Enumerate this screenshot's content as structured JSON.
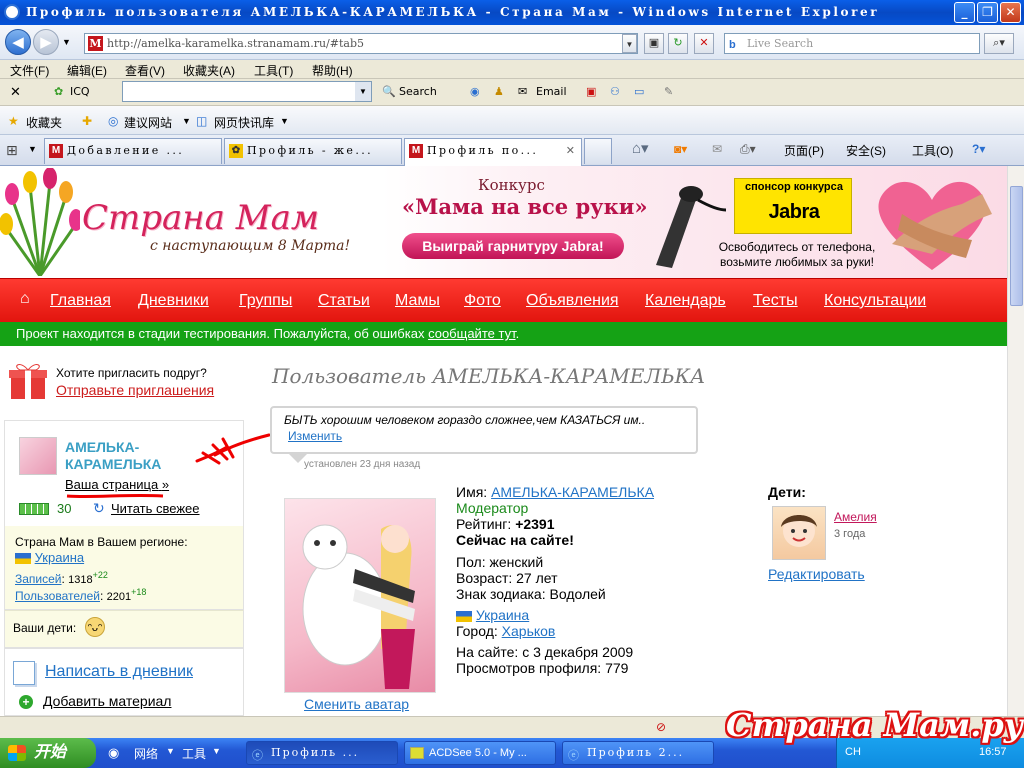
{
  "window": {
    "title": "Профиль пользователя АМЕЛЬКА-КАРАМЕЛЬКА - Страна Мам - Windows Internet Explorer",
    "minimize": "_",
    "maximize": "❐",
    "close": "✕"
  },
  "address": {
    "url": "http://amelka-karamelka.stranamam.ru/#tab5",
    "search_placeholder": "Live Search"
  },
  "menu": [
    "文件(F)",
    "编辑(E)",
    "查看(V)",
    "收藏夹(A)",
    "工具(T)",
    "帮助(H)"
  ],
  "toolbar": {
    "icq": "ICQ",
    "search": "Search",
    "email": "Email"
  },
  "favorites": {
    "fav": "收藏夹",
    "suggest": "建议网站",
    "slices": "网页快讯库"
  },
  "tabs": [
    {
      "title": "Добавление ..."
    },
    {
      "title": "Профиль - же..."
    },
    {
      "title": "Профиль по..."
    }
  ],
  "tab_commands": {
    "page": "页面(P)",
    "safety": "安全(S)",
    "tools": "工具(O)"
  },
  "banner": {
    "logo": "Страна Мам",
    "logo_sub": "с наступающим 8 Марта!",
    "contest_title": "Конкурс",
    "contest_name": "«Мама на все руки»",
    "contest_button": "Выиграй гарнитуру Jabra!",
    "sponsor_label": "спонсор конкурса",
    "sponsor_brand": "Jabra",
    "slogan": "Освободитесь от телефона, возьмите любимых за руки!"
  },
  "nav": [
    "Главная",
    "Дневники",
    "Группы",
    "Статьи",
    "Мамы",
    "Фото",
    "Объявления",
    "Календарь",
    "Тесты",
    "Консультации"
  ],
  "notice": {
    "text": "Проект находится в стадии тестирования. Пожалуйста, об ошибках ",
    "link": "сообщайте тут",
    "tail": "."
  },
  "sidebar": {
    "invite_question": "Хотите пригласить подруг?",
    "invite_link": "Отправьте приглашения",
    "username": "АМЕЛЬКА-КАРАМЕЛЬКА",
    "your_page": "Ваша страница",
    "your_page_arrow": "»",
    "battery_count": "30",
    "refresh": "Читать свежее",
    "region_label": "Страна Мам в Вашем регионе:",
    "region": "Украина",
    "posts_label": "Записей",
    "posts_value": "1318",
    "posts_delta": "+22",
    "users_label": "Пользователей",
    "users_value": "2201",
    "users_delta": "+18",
    "kids_label": "Ваши дети:",
    "write_diary": "Написать в дневник",
    "add_material": "Добавить материал"
  },
  "profile": {
    "title": "Пользователь АМЕЛЬКА-КАРАМЕЛЬКА",
    "status": "БЫТЬ хорошим человеком гораздо сложнее,чем КАЗАТЬСЯ им..",
    "status_edit": "Изменить",
    "status_date": "установлен 23 дня назад",
    "change_avatar": "Сменить аватар",
    "name_label": "Имя:",
    "name": "АМЕЛЬКА-КАРАМЕЛЬКА",
    "role": "Модератор",
    "rating_label": "Рейтинг:",
    "rating": "+2391",
    "online": "Сейчас на сайте!",
    "gender": "Пол: женский",
    "age": "Возраст: 27 лет",
    "zodiac": "Знак зодиака: Водолей",
    "country": "Украина",
    "city_label": "Город:",
    "city": "Харьков",
    "since": "На сайте: с 3 декабря 2009",
    "views": "Просмотров профиля: 779",
    "kids_title": "Дети:",
    "kid_name": "Амелия",
    "kid_age": "3 года",
    "edit_kids": "Редактировать"
  },
  "taskbar": {
    "start": "开始",
    "net": "网络",
    "tools": "工具",
    "tasks": [
      "Профиль ...",
      "ACDSee 5.0 - My ...",
      "Профиль 2..."
    ],
    "lang": "CH",
    "clock": "16:57"
  },
  "watermark": "Страна Мам.ру",
  "colors": {
    "accent_red": "#e2150e",
    "notice_green": "#15a215",
    "link_blue": "#2173c6",
    "logo_pink": "#d4235c"
  }
}
